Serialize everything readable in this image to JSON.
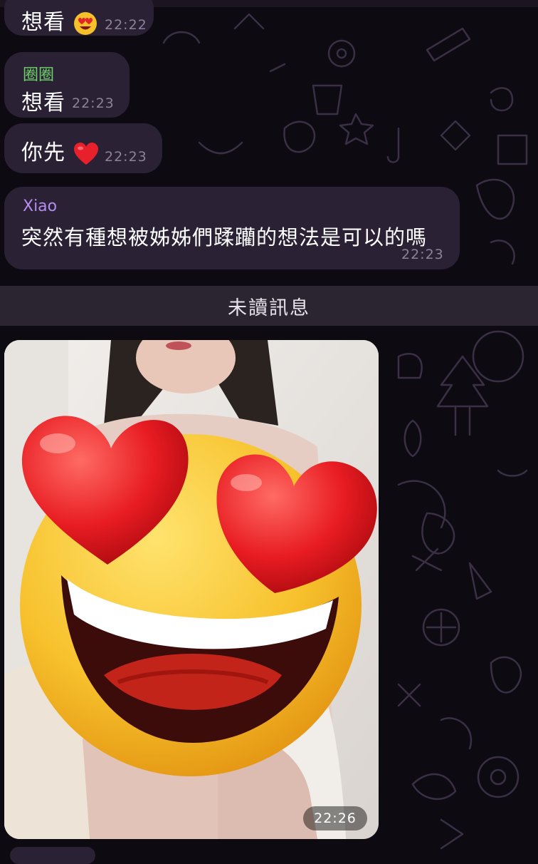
{
  "messages": [
    {
      "text": "想看",
      "emoji": "heart-eyes",
      "time": "22:22"
    },
    {
      "sender": "圈圈",
      "sender_color": "#6fd06a",
      "text": "想看",
      "time": "22:23"
    },
    {
      "text": "你先",
      "emoji": "red-heart",
      "time": "22:23"
    },
    {
      "sender": "Xiao",
      "sender_color": "#b58cf0",
      "text": "突然有種想被姊姊們蹂躪的想法是可以的嗎",
      "time": "22:23"
    }
  ],
  "unread_divider": {
    "label": "未讀訊息"
  },
  "photo_message": {
    "time": "22:26",
    "sticker": "heart-eyes-emoji"
  },
  "colors": {
    "bubble": "#2a2135",
    "background": "#0d0a12",
    "divider": "#2b2531",
    "time_text": "#8c829a"
  }
}
